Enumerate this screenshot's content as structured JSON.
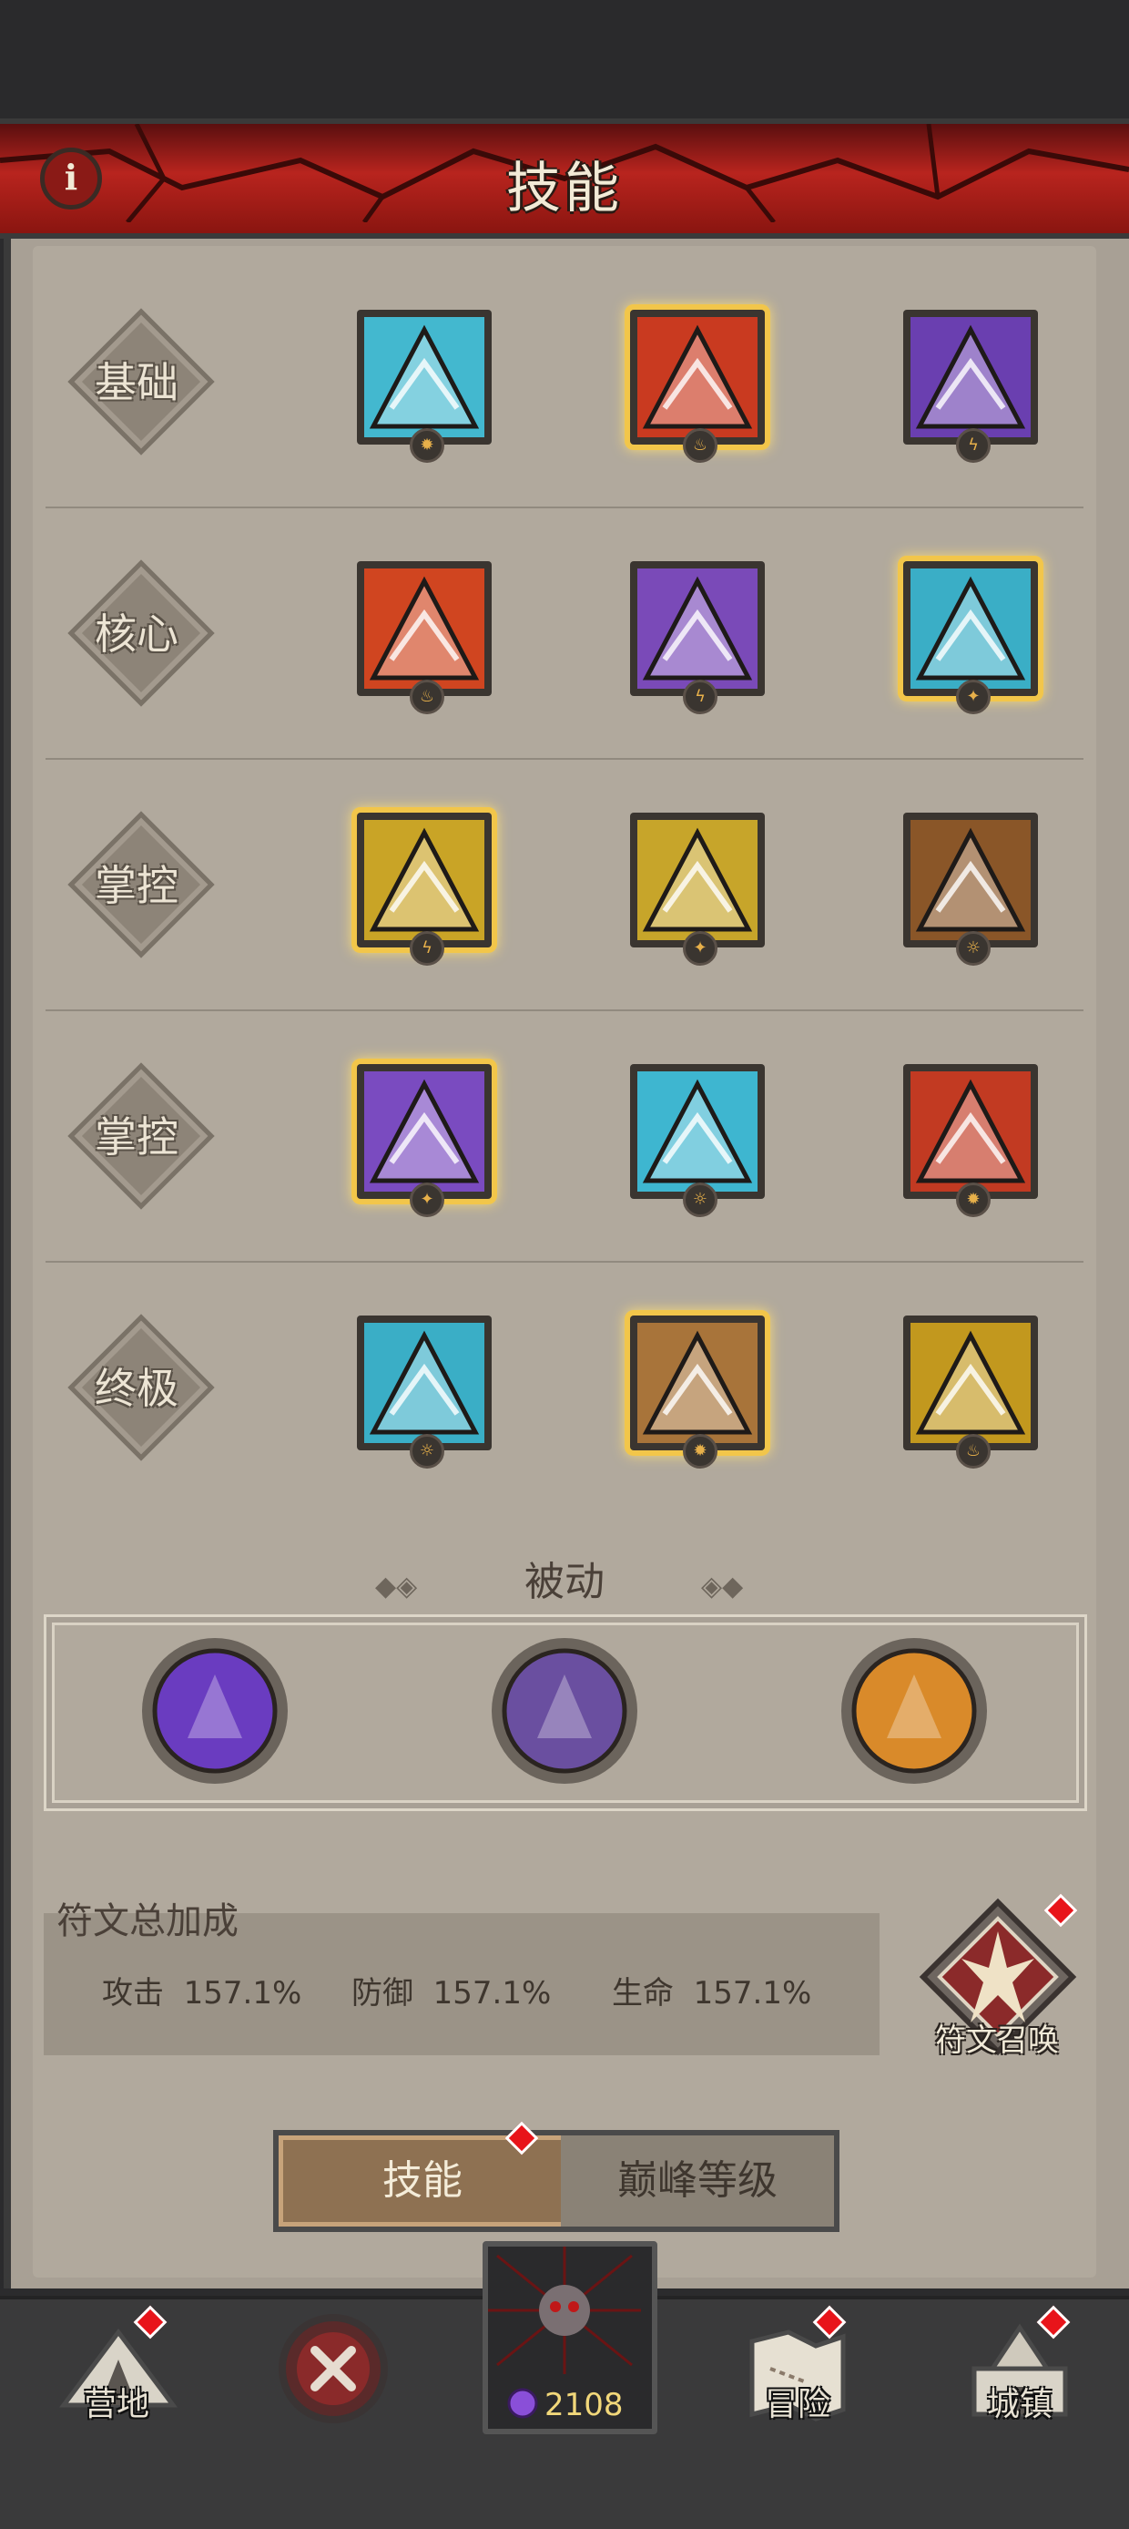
{
  "header": {
    "title": "技能",
    "info_icon": "info-icon",
    "info_label": "i"
  },
  "skill_rows": [
    {
      "label": "基础",
      "skills": [
        {
          "icon": "ice-spike-skill-icon",
          "color": "#43b8cf",
          "selected": false
        },
        {
          "icon": "fire-claw-skill-icon",
          "color": "#c93a20",
          "selected": true
        },
        {
          "icon": "lightning-bolt-skill-icon",
          "color": "#6a3fb0",
          "selected": false
        }
      ]
    },
    {
      "label": "核心",
      "skills": [
        {
          "icon": "fireball-skill-icon",
          "color": "#d04520",
          "selected": false
        },
        {
          "icon": "thunder-fist-skill-icon",
          "color": "#7a4ab8",
          "selected": false
        },
        {
          "icon": "ice-shards-skill-icon",
          "color": "#3aaec6",
          "selected": true
        }
      ]
    },
    {
      "label": "掌控",
      "skills": [
        {
          "icon": "golden-crown-skill-icon",
          "color": "#c9a426",
          "selected": true
        },
        {
          "icon": "golden-spirit-skill-icon",
          "color": "#c7a52a",
          "selected": false
        },
        {
          "icon": "earth-vortex-skill-icon",
          "color": "#8a5628",
          "selected": false
        }
      ]
    },
    {
      "label": "掌控",
      "skills": [
        {
          "icon": "lightning-orb-skill-icon",
          "color": "#7a4bc0",
          "selected": true
        },
        {
          "icon": "frost-nova-skill-icon",
          "color": "#3eb6d0",
          "selected": false
        },
        {
          "icon": "fire-beast-skill-icon",
          "color": "#c23a22",
          "selected": false
        }
      ]
    },
    {
      "label": "终极",
      "skills": [
        {
          "icon": "frost-storm-skill-icon",
          "color": "#3aaec6",
          "selected": false
        },
        {
          "icon": "earth-clones-skill-icon",
          "color": "#a8743a",
          "selected": true
        },
        {
          "icon": "golden-avatar-skill-icon",
          "color": "#c2981e",
          "selected": false
        }
      ]
    }
  ],
  "passive": {
    "title": "被动",
    "items": [
      {
        "icon": "shadow-fist-passive-icon",
        "color": "#6a3cc0"
      },
      {
        "icon": "hooded-mage-passive-icon",
        "color": "#6a4fa0"
      },
      {
        "icon": "golden-rune-passive-icon",
        "color": "#d98a2a"
      }
    ]
  },
  "rune_bonus": {
    "title": "符文总加成",
    "stats": [
      {
        "label": "攻击",
        "value": "157.1%"
      },
      {
        "label": "防御",
        "value": "157.1%"
      },
      {
        "label": "生命",
        "value": "157.1%"
      }
    ],
    "summon_label": "符文召唤"
  },
  "tabs": {
    "skill": "技能",
    "peak_level": "巅峰等级"
  },
  "bottom_nav": {
    "camp": "营地",
    "adventure": "冒险",
    "town": "城镇",
    "gem_count": "2108"
  },
  "colors": {
    "banner_red": "#b8241e",
    "selected_gold": "#f2c64a",
    "notification_red": "#e8141a"
  }
}
